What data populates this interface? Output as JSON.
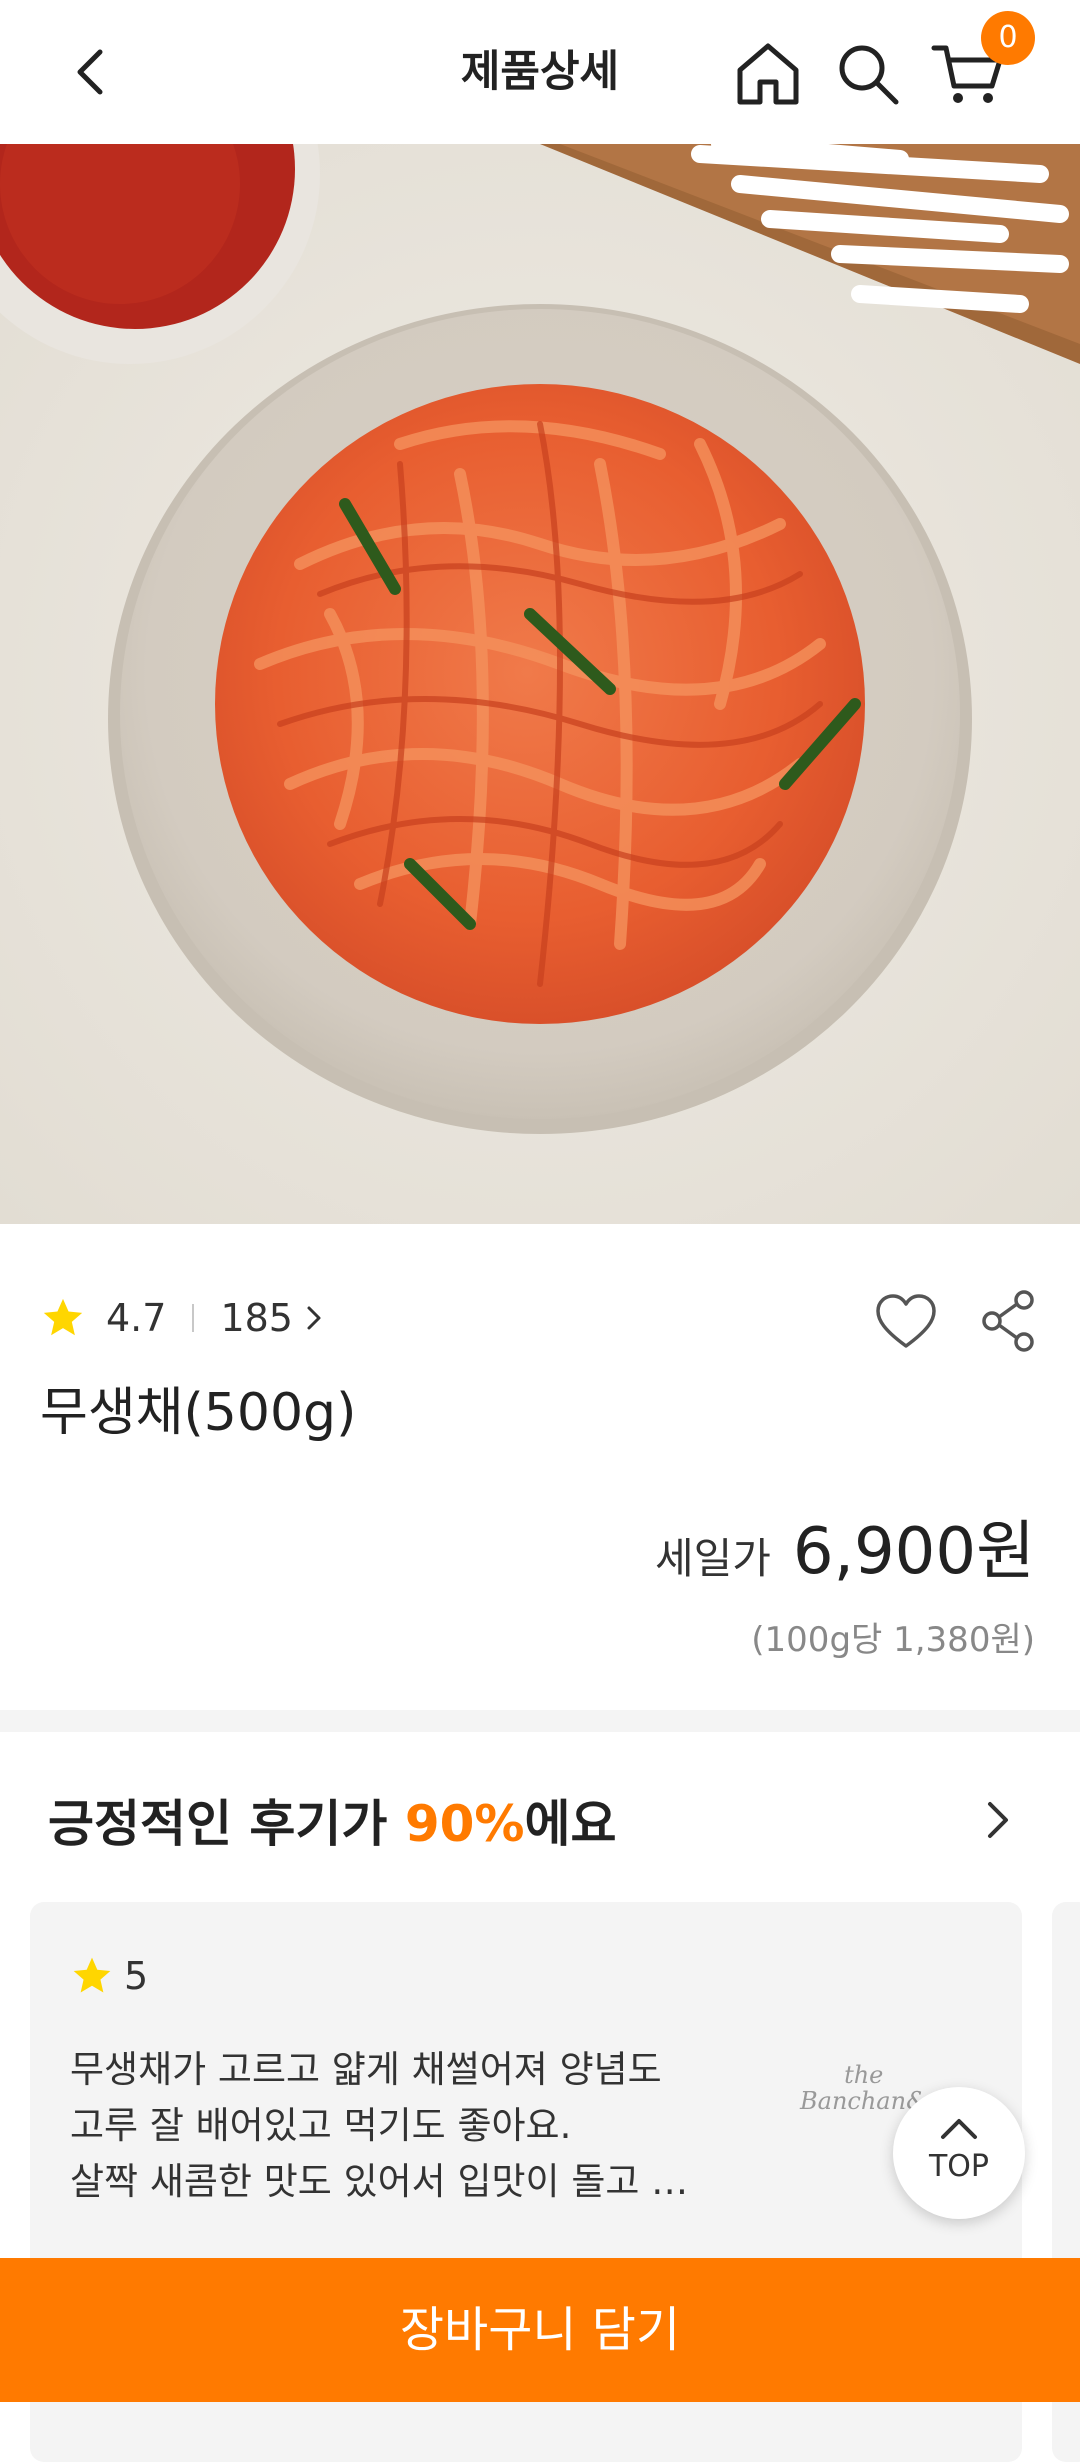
{
  "header": {
    "title": "제품상세",
    "cart_count": "0",
    "icons": [
      "back-arrow-icon",
      "home-icon",
      "search-icon",
      "cart-icon"
    ]
  },
  "product": {
    "rating": "4.7",
    "review_count": "185",
    "name": "무생채(500g)",
    "sale_label": "세일가",
    "price": "6,900원",
    "unit_price": "(100g당 1,380원)"
  },
  "reviews": {
    "title_prefix": "긍정적인 후기가 ",
    "title_highlight": "90%",
    "title_suffix": "에요",
    "items": [
      {
        "rating": "5",
        "line1": "무생채가 고르고 얇게 채썰어져 양념도",
        "line2": "고루 잘 배어있고 먹기도 좋아요.",
        "line3": "살짝 새콤한 맛도 있어서 입맛이 돌고 …",
        "brand_small": "the",
        "brand_name": "Banchan&"
      }
    ]
  },
  "top_button": "TOP",
  "cta": "장바구니 담기",
  "colors": {
    "accent": "#ff7a00",
    "star": "#ffd600"
  }
}
